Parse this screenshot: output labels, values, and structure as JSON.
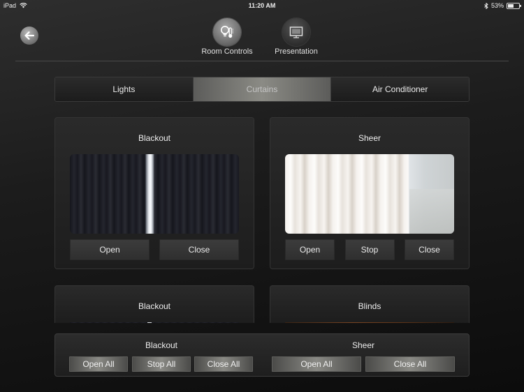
{
  "status_bar": {
    "device": "iPad",
    "time": "11:20 AM",
    "battery": "53%",
    "battery_level": 0.53
  },
  "header": {
    "back_icon": "arrow-left-icon",
    "nav": [
      {
        "label": "Room Controls",
        "icon": "lightbulb-thermometer-icon",
        "active": true
      },
      {
        "label": "Presentation",
        "icon": "projector-screen-icon",
        "active": false
      }
    ]
  },
  "tabs": [
    {
      "label": "Lights",
      "active": false
    },
    {
      "label": "Curtains",
      "active": true
    },
    {
      "label": "Air Conditioner",
      "active": false
    }
  ],
  "panels": [
    {
      "title": "Blackout",
      "buttons": [
        "Open",
        "Close"
      ]
    },
    {
      "title": "Sheer",
      "buttons": [
        "Open",
        "Stop",
        "Close"
      ]
    },
    {
      "title": "Blackout"
    },
    {
      "title": "Blinds"
    }
  ],
  "bottom_bar": {
    "groups": [
      {
        "label": "Blackout",
        "buttons": [
          "Open All",
          "Stop All",
          "Close All"
        ]
      },
      {
        "label": "Sheer",
        "buttons": [
          "Open All",
          "Close All"
        ]
      }
    ]
  },
  "colors": {
    "background": "#1a1a1a",
    "panel": "#262626",
    "active_tab": "#8b8b85",
    "button": "#363636"
  }
}
